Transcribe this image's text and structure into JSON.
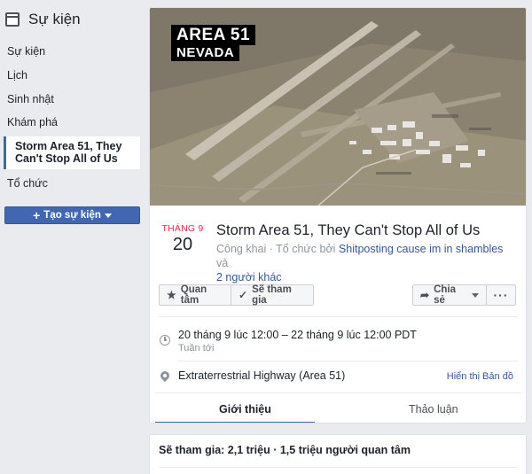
{
  "sidebar": {
    "title": "Sự kiện",
    "items": [
      {
        "label": "Sự kiện"
      },
      {
        "label": "Lịch"
      },
      {
        "label": "Sinh nhật"
      },
      {
        "label": "Khám phá"
      },
      {
        "label": "Storm Area 51, They Can't Stop All of Us"
      },
      {
        "label": "Tổ chức"
      }
    ],
    "create_button": "Tạo sự kiện"
  },
  "cover": {
    "label_line1": "AREA 51",
    "label_line2": "NEVADA"
  },
  "event": {
    "month": "THÁNG 9",
    "day": "20",
    "title": "Storm Area 51, They Can't Stop All of Us",
    "meta_prefix": "Công khai · Tổ chức bởi ",
    "organizer": "Shitposting cause im in shambles",
    "meta_and": " và",
    "others": "2 người khác"
  },
  "actions": {
    "interested": "Quan tâm",
    "going": "Sẽ tham gia",
    "share": "Chia sẻ",
    "more": "···"
  },
  "details": {
    "time": "20 tháng 9 lúc 12:00 – 22 tháng 9 lúc 12:00 PDT",
    "time_sub": "Tuần tới",
    "location": "Extraterrestrial Highway (Area 51)",
    "show_map": "Hiển thị Bản đồ"
  },
  "tabs": {
    "about": "Giới thiệu",
    "discussion": "Thảo luận"
  },
  "summary": {
    "going_line": "Sẽ tham gia: 2,1 triệu · 1,5 triệu người quan tâm"
  },
  "colors": {
    "accent": "#4267b2",
    "month_red": "#f02849",
    "link": "#365899"
  }
}
